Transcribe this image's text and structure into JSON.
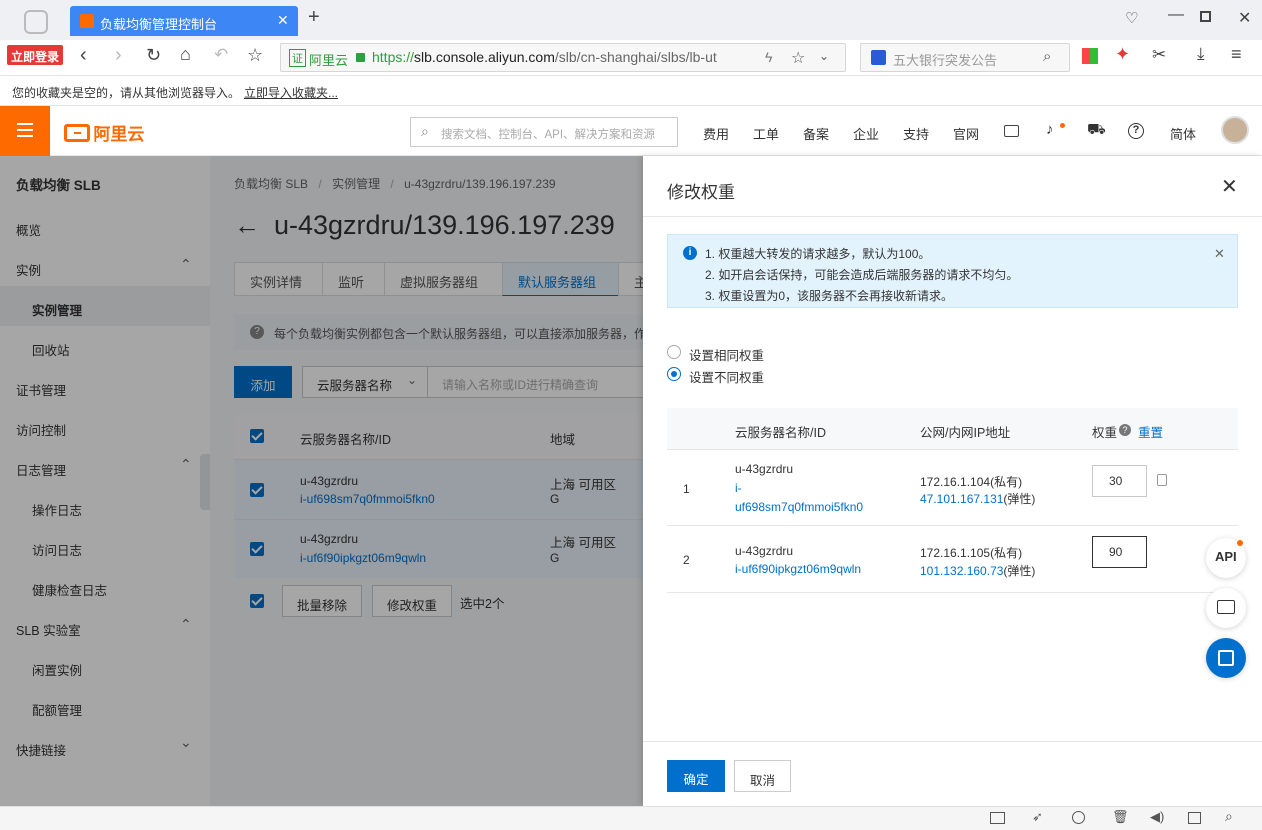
{
  "browser": {
    "tab_title": "负载均衡管理控制台",
    "login_badge": "立即登录",
    "url_badge": "证",
    "url_site": "阿里云",
    "url_scheme": "https://",
    "url_host": "slb.console.aliyun.com",
    "url_path": "/slb/cn-shanghai/slbs/lb-ut",
    "search_placeholder": "五大银行突发公告",
    "bookmarks_empty": "您的收藏夹是空的，请从其他浏览器导入。",
    "bookmarks_import": "立即导入收藏夹..."
  },
  "header": {
    "logo_text": "阿里云",
    "search_placeholder": "搜索文档、控制台、API、解决方案和资源",
    "nav": [
      "费用",
      "工单",
      "备案",
      "企业",
      "支持",
      "官网"
    ],
    "lang": "简体"
  },
  "sidebar": {
    "title": "负载均衡 SLB",
    "items": [
      {
        "label": "概览",
        "level": 1
      },
      {
        "label": "实例",
        "level": 1,
        "expandable": true
      },
      {
        "label": "实例管理",
        "level": 2,
        "active": true
      },
      {
        "label": "回收站",
        "level": 2
      },
      {
        "label": "证书管理",
        "level": 1
      },
      {
        "label": "访问控制",
        "level": 1
      },
      {
        "label": "日志管理",
        "level": 1,
        "expandable": true
      },
      {
        "label": "操作日志",
        "level": 2
      },
      {
        "label": "访问日志",
        "level": 2
      },
      {
        "label": "健康检查日志",
        "level": 2
      },
      {
        "label": "SLB 实验室",
        "level": 1,
        "expandable": true
      },
      {
        "label": "闲置实例",
        "level": 2
      },
      {
        "label": "配额管理",
        "level": 2
      },
      {
        "label": "快捷链接",
        "level": 1,
        "expandable": true
      }
    ]
  },
  "main": {
    "breadcrumb": [
      "负载均衡 SLB",
      "实例管理",
      "u-43gzrdru/139.196.197.239"
    ],
    "page_title": "u-43gzrdru/139.196.197.239",
    "tabs": [
      "实例详情",
      "监听",
      "虚拟服务器组",
      "默认服务器组",
      "主"
    ],
    "active_tab": "默认服务器组",
    "info_text": "每个负载均衡实例都包含一个默认服务器组，可以直接添加服务器，作",
    "add_button": "添加",
    "filter_select": "云服务器名称",
    "filter_placeholder": "请输入名称或ID进行精确查询",
    "table_headers": [
      "云服务器名称/ID",
      "地域"
    ],
    "rows": [
      {
        "name": "u-43gzrdru",
        "id": "i-uf698sm7q0fmmoi5fkn0",
        "region": "上海 可用区",
        "zone": "G"
      },
      {
        "name": "u-43gzrdru",
        "id": "i-uf6f90ipkgzt06m9qwln",
        "region": "上海 可用区",
        "zone": "G"
      }
    ],
    "batch_remove": "批量移除",
    "modify_weight": "修改权重",
    "selected_count": "选中2个"
  },
  "drawer": {
    "title": "修改权重",
    "notice_lines": [
      "1. 权重越大转发的请求越多，默认为100。",
      "2. 如开启会话保持，可能会造成后端服务器的请求不均匀。",
      "3. 权重设置为0，该服务器不会再接收新请求。"
    ],
    "radio_same": "设置相同权重",
    "radio_diff": "设置不同权重",
    "col_name": "云服务器名称/ID",
    "col_ip": "公网/内网IP地址",
    "col_weight": "权重",
    "reset": "重置",
    "rows": [
      {
        "index": "1",
        "name": "u-43gzrdru",
        "id_part1": "i-",
        "id_part2": "uf698sm7q0fmmoi5fkn0",
        "private_ip": "172.16.1.104(私有)",
        "public_ip": "47.101.167.131",
        "public_suffix": "(弹性)",
        "weight": "30"
      },
      {
        "index": "2",
        "name": "u-43gzrdru",
        "id": "i-uf6f90ipkgzt06m9qwln",
        "private_ip": "172.16.1.105(私有)",
        "public_ip": "101.132.160.73",
        "public_suffix": "(弹性)",
        "weight": "90"
      }
    ],
    "ok": "确定",
    "cancel": "取消"
  },
  "floating": {
    "api": "API"
  },
  "colors": {
    "brand": "#ff6a00",
    "primary": "#0070cc",
    "tab_blue": "#3d86f5"
  }
}
